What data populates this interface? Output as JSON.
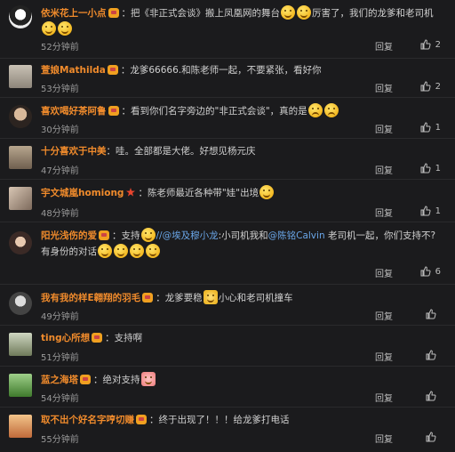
{
  "reply_label": "回复",
  "comments": [
    {
      "username": "依米花上一小点",
      "content_a": "把《非正式会谈》搬上凤凰网的舞台",
      "content_b": "厉害了，我们的龙爹和老司机",
      "time": "52分钟前",
      "likes": "2"
    },
    {
      "username": "萱娘Mathilda",
      "content_a": "龙爹66666.和陈老师一起，不要紧张，看好你",
      "time": "53分钟前",
      "likes": "2"
    },
    {
      "username": "喜欢喝好茶阿鲁",
      "content_a": "看到你们名字旁边的\"非正式会谈\"，真的是",
      "time": "30分钟前",
      "likes": "1"
    },
    {
      "username": "十分喜欢于中美",
      "content_a": "哇。全部都是大佬。好想见杨元庆",
      "time": "47分钟前",
      "likes": "1"
    },
    {
      "username": "宇文城嵐homiong",
      "content_a": "陈老师最近各种带\"娃\"出境",
      "time": "48分钟前",
      "likes": "1"
    },
    {
      "username": "阳光浅伤的爱",
      "content_a": "支持",
      "mention1": "//@埃及穆小龙",
      "content_b": ":小司机我和",
      "mention2": "@陈铭Calvin",
      "content_c": "老司机一起，你们支持不?",
      "content_d": "有身份的对话",
      "time": "",
      "likes": "6"
    },
    {
      "username": "我有我的样E翱翔的羽毛",
      "content_a": "龙爹要稳",
      "content_b": "小心和老司机撞车",
      "time": "49分钟前",
      "likes": ""
    },
    {
      "username": "ting心所想",
      "content_a": "支持啊",
      "time": "51分钟前",
      "likes": ""
    },
    {
      "username": "蓝之海塔",
      "content_a": "绝对支持",
      "time": "54分钟前",
      "likes": ""
    },
    {
      "username": "取不出个好名字哼切赚",
      "content_a": "终于出现了！！！给龙爹打电话",
      "time": "55分钟前",
      "likes": ""
    }
  ]
}
